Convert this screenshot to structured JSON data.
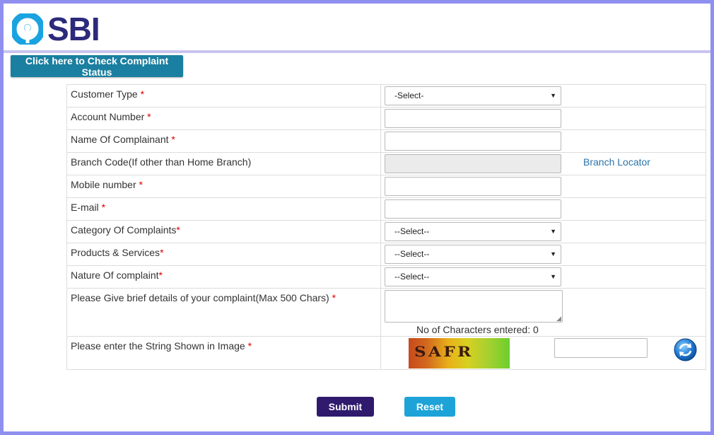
{
  "brand": {
    "name": "SBI",
    "logo_color": "#1aa3e0",
    "text_color": "#2c2a7a"
  },
  "status_button": {
    "label": "Click here to Check Complaint Status"
  },
  "form": {
    "customer_type": {
      "label": "Customer Type",
      "required": "*",
      "value": "-Select-"
    },
    "account_number": {
      "label": "Account Number",
      "required": "*",
      "value": ""
    },
    "name": {
      "label": "Name Of Complainant",
      "required": "*",
      "value": ""
    },
    "branch_code": {
      "label": "Branch Code(If other than Home Branch)",
      "value": "",
      "link": "Branch Locator"
    },
    "mobile": {
      "label": "Mobile number",
      "required": "*",
      "value": ""
    },
    "email": {
      "label": "E-mail",
      "required": "*",
      "value": ""
    },
    "category": {
      "label": "Category Of Complaints",
      "required": "*",
      "value": "--Select--"
    },
    "products": {
      "label": "Products & Services",
      "required": "*",
      "value": "--Select--"
    },
    "nature": {
      "label": "Nature Of complaint",
      "required": "*",
      "value": "--Select--"
    },
    "details": {
      "label": "Please Give brief details of your complaint(Max 500 Chars) ",
      "required": "*",
      "char_count": "No of Characters entered: 0"
    },
    "captcha": {
      "label": "Please enter the String Shown in Image ",
      "required": "*",
      "image_text": "SAFR",
      "value": ""
    }
  },
  "actions": {
    "submit_label": "Submit",
    "reset_label": "Reset"
  },
  "colors": {
    "status_button": "#1a7fa0",
    "submit": "#2f1a6e",
    "reset": "#1ea3d8",
    "required": "#dd0000",
    "link": "#2a73a8"
  }
}
